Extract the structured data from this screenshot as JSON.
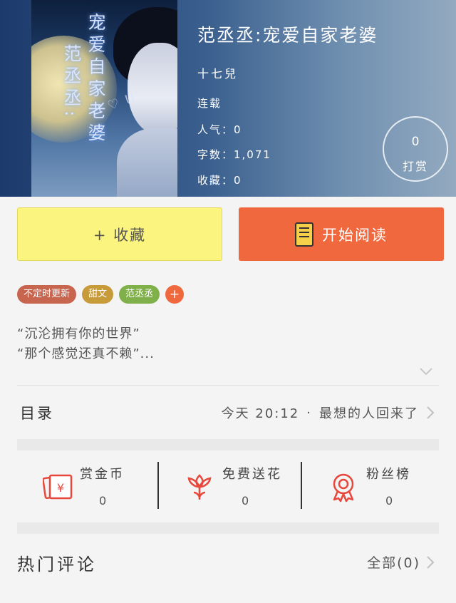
{
  "book": {
    "title": "范丞丞:宠爱自家老婆",
    "cover_title_col1": "宠爱自家老婆",
    "cover_title_col2": "范丞丞:",
    "author": "十七兒",
    "status": "连载",
    "popularity_label": "人气：0",
    "word_count_label": "字数：1,071",
    "favorites_label": "收藏：0"
  },
  "tip": {
    "count": "0",
    "label": "打赏"
  },
  "actions": {
    "favorite_label": "+ 收藏",
    "read_label": "开始阅读"
  },
  "tags": [
    {
      "label": "不定时更新",
      "color": "#c8654f"
    },
    {
      "label": "甜文",
      "color": "#c79a3a"
    },
    {
      "label": "范丞丞",
      "color": "#7fb04a"
    }
  ],
  "tag_add_label": "+",
  "description": {
    "line1": "“沉沦拥有你的世界”",
    "line2": "“那个感觉还真不赖”..."
  },
  "catalog": {
    "label": "目录",
    "update_time": "今天 20:12",
    "separator": "·",
    "latest_chapter": "最想的人回来了"
  },
  "stats": [
    {
      "label": "赏金币",
      "value": "0",
      "icon": "red-envelope-icon"
    },
    {
      "label": "免费送花",
      "value": "0",
      "icon": "flower-icon"
    },
    {
      "label": "粉丝榜",
      "value": "0",
      "icon": "medal-icon"
    }
  ],
  "comments": {
    "label": "热门评论",
    "all_label": "全部(0)"
  },
  "colors": {
    "accent": "#f0683d",
    "favorite_bg": "#fbf47e",
    "icon_red": "#e8473b"
  }
}
